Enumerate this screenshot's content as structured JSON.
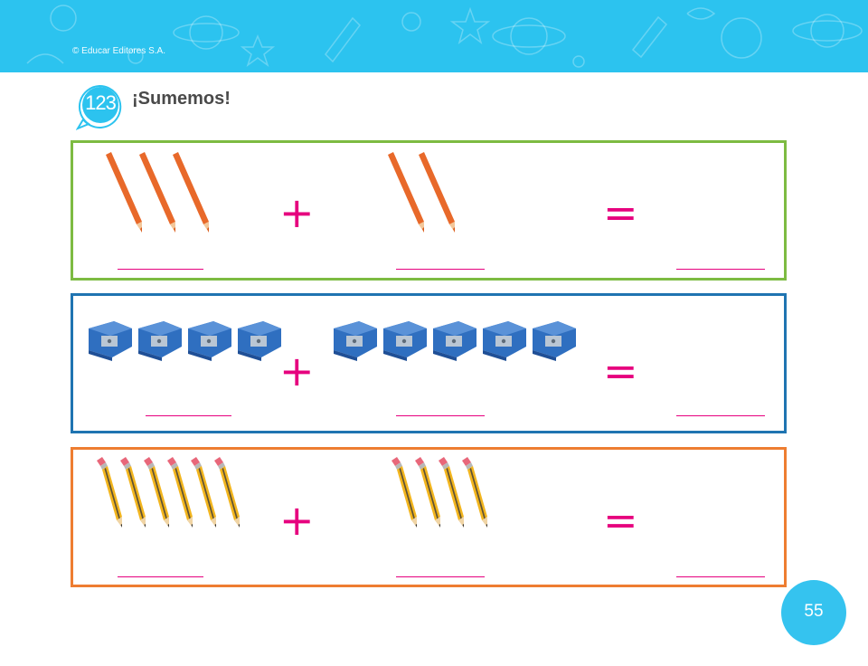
{
  "header": {
    "copyright": "© Educar Editores S.A.",
    "color": "#2cc3ef"
  },
  "activity": {
    "badge": "123",
    "title": "¡Sumemos!"
  },
  "rows": [
    {
      "item": "colored-pencil",
      "left_count": 3,
      "right_count": 2,
      "operator": "+",
      "equals": "=",
      "border_color": "#7dbb42"
    },
    {
      "item": "sharpener",
      "left_count": 4,
      "right_count": 5,
      "operator": "+",
      "equals": "=",
      "border_color": "#1f74b1"
    },
    {
      "item": "graphite-pencil",
      "left_count": 6,
      "right_count": 4,
      "operator": "+",
      "equals": "=",
      "border_color": "#ee7d31"
    }
  ],
  "accent_color": "#e6007e",
  "page": {
    "number": "55"
  }
}
